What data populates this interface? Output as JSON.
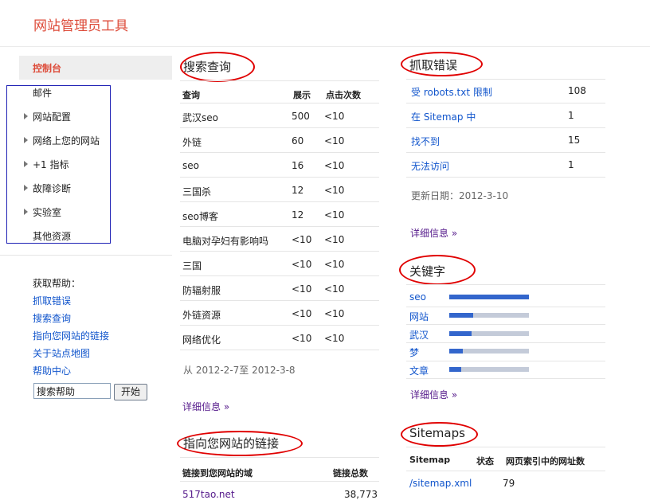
{
  "app": {
    "title": "网站管理员工具"
  },
  "sidebar": {
    "active": "控制台",
    "items": [
      {
        "label": "邮件",
        "expandable": false
      },
      {
        "label": "网站配置",
        "expandable": true
      },
      {
        "label": "网络上您的网站",
        "expandable": true
      },
      {
        "label": "+1 指标",
        "expandable": true
      },
      {
        "label": "故障诊断",
        "expandable": true
      },
      {
        "label": "实验室",
        "expandable": true
      },
      {
        "label": "其他资源",
        "expandable": false
      }
    ],
    "help": {
      "title": "获取帮助：",
      "links": [
        "抓取错误",
        "搜索查询",
        "指向您网站的链接",
        "关于站点地图",
        "帮助中心"
      ],
      "search_value": "搜索帮助",
      "search_button": "开始"
    }
  },
  "search_queries": {
    "title": "搜索查询",
    "headers": [
      "查询",
      "展示",
      "点击次数"
    ],
    "rows": [
      {
        "query": "武汉seo",
        "impressions": "500",
        "clicks": "<10"
      },
      {
        "query": "外链",
        "impressions": "60",
        "clicks": "<10"
      },
      {
        "query": "seo",
        "impressions": "16",
        "clicks": "<10"
      },
      {
        "query": "三国杀",
        "impressions": "12",
        "clicks": "<10"
      },
      {
        "query": "seo博客",
        "impressions": "12",
        "clicks": "<10"
      },
      {
        "query": "电脑对孕妇有影响吗",
        "impressions": "<10",
        "clicks": "<10"
      },
      {
        "query": "三国",
        "impressions": "<10",
        "clicks": "<10"
      },
      {
        "query": "防辐射服",
        "impressions": "<10",
        "clicks": "<10"
      },
      {
        "query": "外链资源",
        "impressions": "<10",
        "clicks": "<10"
      },
      {
        "query": "网络优化",
        "impressions": "<10",
        "clicks": "<10"
      }
    ],
    "date_range": "从 2012-2-7至 2012-3-8",
    "more": "详细信息 »"
  },
  "links_to_site": {
    "title": "指向您网站的链接",
    "headers": [
      "链接到您网站的域",
      "链接总数"
    ],
    "rows": [
      {
        "domain": "517tao.net",
        "count": "38,773"
      }
    ]
  },
  "crawl_errors": {
    "title": "抓取错误",
    "rows": [
      {
        "label": "受 robots.txt 限制",
        "count": "108"
      },
      {
        "label": "在 Sitemap 中",
        "count": "1"
      },
      {
        "label": "找不到",
        "count": "15"
      },
      {
        "label": "无法访问",
        "count": "1"
      }
    ],
    "updated": "更新日期：2012-3-10",
    "more": "详细信息 »"
  },
  "keywords": {
    "title": "关键字",
    "items": [
      {
        "word": "seo",
        "level": 1.0
      },
      {
        "word": "网站",
        "level": 0.3
      },
      {
        "word": "武汉",
        "level": 0.28
      },
      {
        "word": "梦",
        "level": 0.17
      },
      {
        "word": "文章",
        "level": 0.15
      }
    ],
    "more": "详细信息 »"
  },
  "sitemaps": {
    "title": "Sitemaps",
    "headers": [
      "Sitemap",
      "状态",
      "网页索引中的网址数"
    ],
    "rows": [
      {
        "path": "/sitemap.xml",
        "status": "",
        "indexed": "79"
      }
    ]
  },
  "colors": {
    "brand": "#dd4b39",
    "link": "#1155cc",
    "visited": "#551a8b",
    "highlight": "#e00000",
    "bar": "#3366cc",
    "bar_bg": "#c4cbd9",
    "nav_border": "#1f22b5"
  }
}
